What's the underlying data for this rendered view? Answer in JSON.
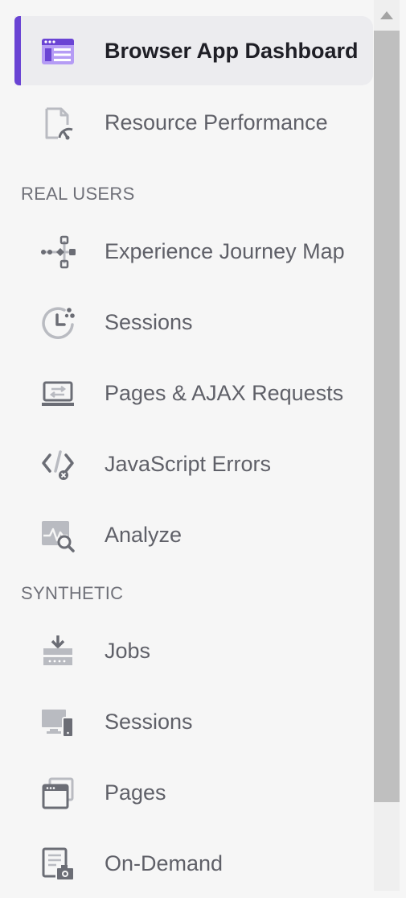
{
  "nav": {
    "top_items": [
      {
        "label": "Browser App Dashboard",
        "icon": "dashboard-icon",
        "active": true
      },
      {
        "label": "Resource Performance",
        "icon": "resource-performance-icon",
        "active": false
      }
    ],
    "sections": [
      {
        "header": "REAL USERS",
        "items": [
          {
            "label": "Experience Journey Map",
            "icon": "journey-map-icon"
          },
          {
            "label": "Sessions",
            "icon": "sessions-clock-icon"
          },
          {
            "label": "Pages & AJAX Requests",
            "icon": "laptop-requests-icon"
          },
          {
            "label": "JavaScript Errors",
            "icon": "code-error-icon"
          },
          {
            "label": "Analyze",
            "icon": "analyze-chart-search-icon"
          }
        ]
      },
      {
        "header": "SYNTHETIC",
        "items": [
          {
            "label": "Jobs",
            "icon": "jobs-download-icon"
          },
          {
            "label": "Sessions",
            "icon": "devices-icon"
          },
          {
            "label": "Pages",
            "icon": "pages-windows-icon"
          },
          {
            "label": "On-Demand",
            "icon": "document-camera-icon"
          }
        ]
      }
    ]
  },
  "colors": {
    "accent": "#6a44d4",
    "accent_light": "#b59cf5",
    "icon_gray": "#6b6d75",
    "icon_light": "#b9bbc1",
    "active_bg": "#ececef",
    "scroll_thumb": "#bfbfbf"
  }
}
